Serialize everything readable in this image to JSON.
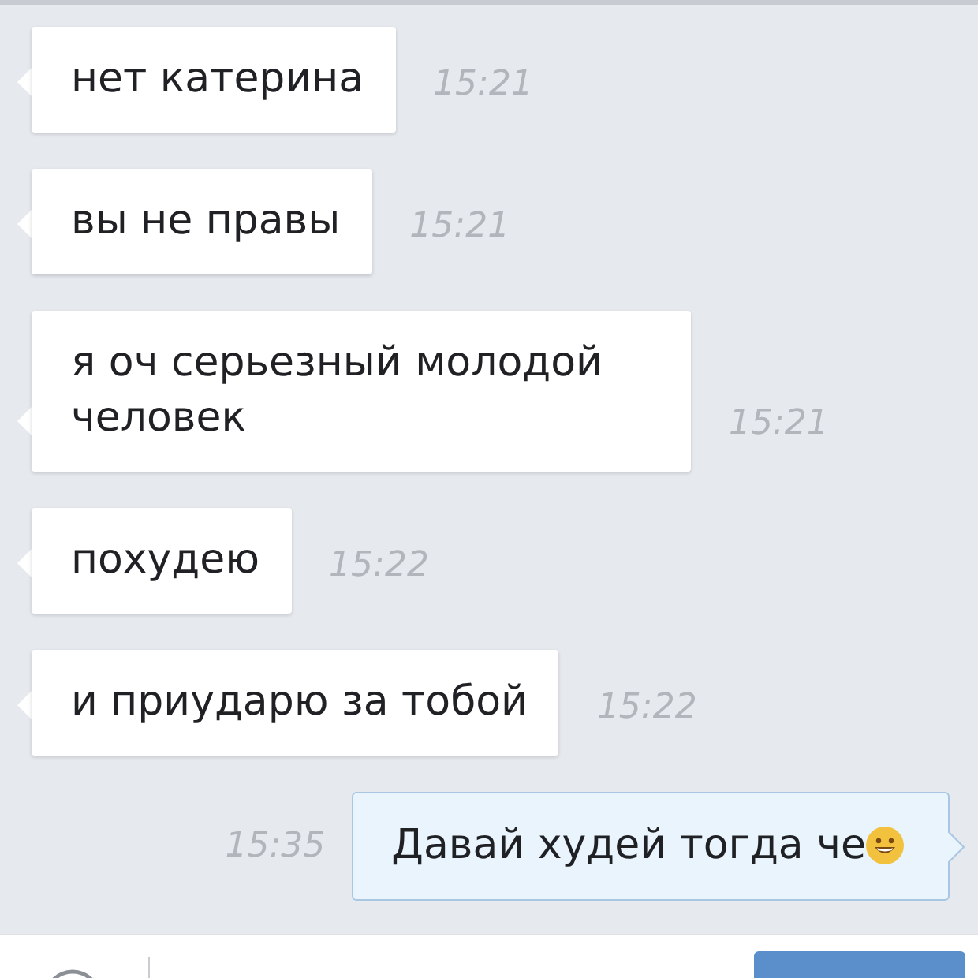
{
  "messages": [
    {
      "kind": "incoming",
      "text": "нет катерина",
      "time": "15:21",
      "emoji": false
    },
    {
      "kind": "incoming",
      "text": "вы не правы",
      "time": "15:21",
      "emoji": false
    },
    {
      "kind": "incoming",
      "text": "я оч серьезный молодой человек",
      "time": "15:21",
      "emoji": false
    },
    {
      "kind": "incoming",
      "text": "похудею",
      "time": "15:22",
      "emoji": false
    },
    {
      "kind": "incoming",
      "text": "и приударю за тобой",
      "time": "15:22",
      "emoji": false
    },
    {
      "kind": "outgoing",
      "text": "Давай худей тогда че",
      "time": "15:35",
      "emoji": true
    }
  ]
}
